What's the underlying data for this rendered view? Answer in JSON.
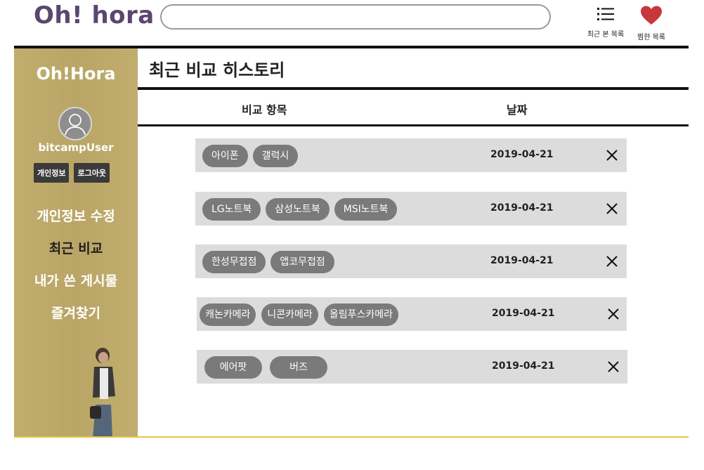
{
  "header": {
    "logo": "Oh! hora",
    "search_placeholder": "",
    "recent_label": "최근 본 목록",
    "recent_icon": "list-icon",
    "fav_label": "찜한 목록",
    "fav_icon": "heart-icon",
    "fav_color": "#c8373b"
  },
  "sidebar": {
    "title": "Oh!Hora",
    "username": "bitcampUser",
    "buttons": [
      "개인정보",
      "로그아웃"
    ],
    "menu": [
      "개인정보 수정",
      "최근 비교",
      "내가 쓴 게시물",
      "즐겨찾기"
    ],
    "active_index": 1,
    "bg_color": "#bca969"
  },
  "main": {
    "title": "최근 비교 히스토리",
    "col_items": "비교 항목",
    "col_date": "날짜",
    "rows": [
      {
        "items": [
          "아이폰",
          "갤럭시"
        ],
        "date": "2019-04-21"
      },
      {
        "items": [
          "LG노트북",
          "삼성노트북",
          "MSI노트북"
        ],
        "date": "2019-04-21"
      },
      {
        "items": [
          "한성무접점",
          "앱코무접점"
        ],
        "date": "2019-04-21"
      },
      {
        "items": [
          "캐논카메라",
          "니콘카메라",
          "올림푸스카메라"
        ],
        "date": "2019-04-21"
      },
      {
        "items": [
          "에어팟",
          "버즈"
        ],
        "date": "2019-04-21"
      }
    ]
  }
}
